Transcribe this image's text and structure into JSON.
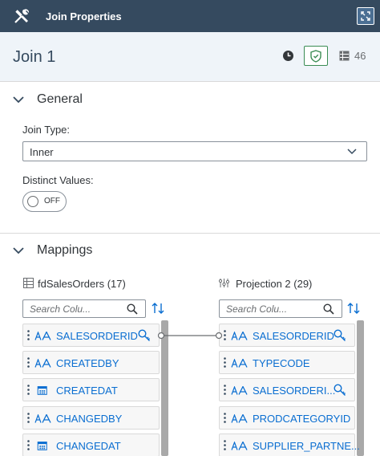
{
  "topbar": {
    "title": "Join Properties",
    "tools_icon": "tools-icon",
    "expand_icon": "expand-icon"
  },
  "join": {
    "title": "Join 1",
    "column_count": "46"
  },
  "general": {
    "section_title": "General",
    "join_type_label": "Join Type:",
    "join_type_value": "Inner",
    "distinct_label": "Distinct Values:",
    "distinct_value": "OFF"
  },
  "mappings": {
    "section_title": "Mappings",
    "left": {
      "name": "fdSalesOrders (17)",
      "search_placeholder": "Search Colu...",
      "columns": [
        {
          "name": "SALESORDERID",
          "type": "string",
          "key": true
        },
        {
          "name": "CREATEDBY",
          "type": "string",
          "key": false
        },
        {
          "name": "CREATEDAT",
          "type": "date",
          "key": false
        },
        {
          "name": "CHANGEDBY",
          "type": "string",
          "key": false
        },
        {
          "name": "CHANGEDAT",
          "type": "date",
          "key": false
        }
      ]
    },
    "right": {
      "name": "Projection 2 (29)",
      "search_placeholder": "Search Colu...",
      "columns": [
        {
          "name": "SALESORDERID",
          "type": "string",
          "key": true
        },
        {
          "name": "TYPECODE",
          "type": "string",
          "key": false
        },
        {
          "name": "SALESORDERI...",
          "type": "string",
          "key": true
        },
        {
          "name": "PRODCATEGORYID",
          "type": "string",
          "key": false
        },
        {
          "name": "SUPPLIER_PARTNE...",
          "type": "string",
          "key": false
        }
      ]
    }
  },
  "colors": {
    "header": "#354a5f",
    "accent": "#0a6ed1",
    "shield": "#3a8c54"
  }
}
